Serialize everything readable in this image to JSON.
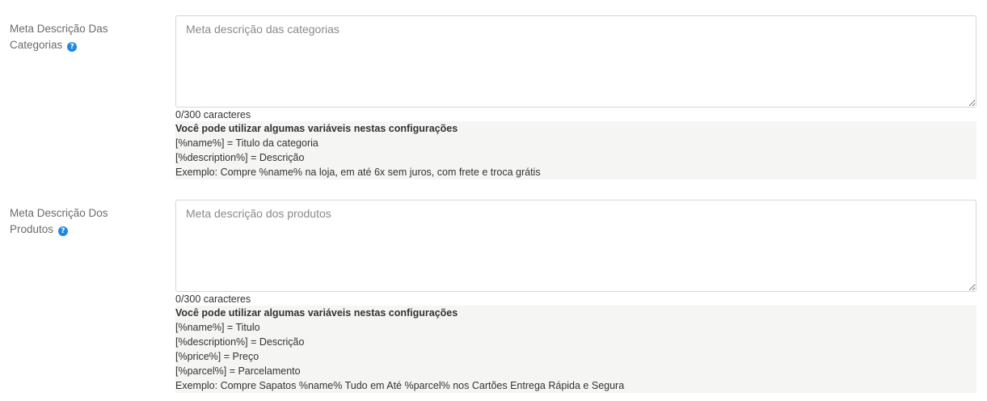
{
  "fields": [
    {
      "label_line1": "Meta Descrição Das",
      "label_line2": "Categorias",
      "placeholder": "Meta descrição das categorias",
      "counter": "0/300 caracteres",
      "help_title": "Você pode utilizar algumas variáveis nestas configurações",
      "help_lines": [
        "[%name%] = Titulo da categoria",
        "[%description%] = Descrição",
        "Exemplo: Compre %name% na loja, em até 6x sem juros, com frete e troca grátis"
      ]
    },
    {
      "label_line1": "Meta Descrição Dos",
      "label_line2": "Produtos",
      "placeholder": "Meta descrição dos produtos",
      "counter": "0/300 caracteres",
      "help_title": "Você pode utilizar algumas variáveis nestas configurações",
      "help_lines": [
        "[%name%] = Titulo",
        "[%description%] = Descrição",
        "[%price%] = Preço",
        "[%parcel%] = Parcelamento",
        "Exemplo: Compre Sapatos %name% Tudo em Até %parcel% nos Cartões Entrega Rápida e Segura"
      ]
    }
  ],
  "icons": {
    "help": "question-circle-icon",
    "help_glyph": "?"
  },
  "colors": {
    "help_icon": "#1e88e5",
    "help_box_bg": "#f5f5f3",
    "label": "#6b6b6b",
    "border": "#d6d6d6"
  }
}
